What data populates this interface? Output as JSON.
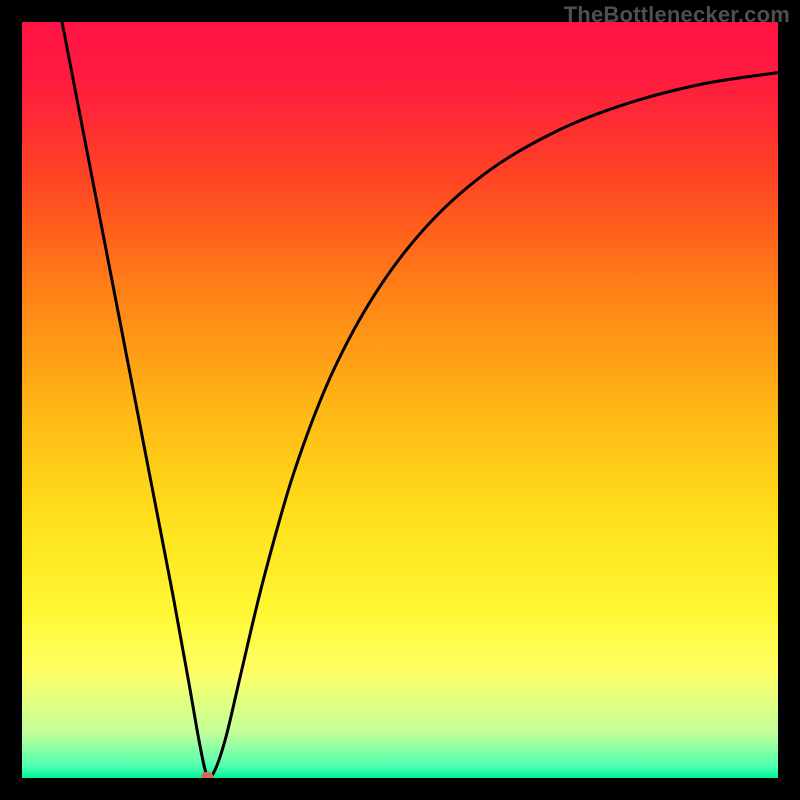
{
  "watermark": "TheBottlenecker.com",
  "chart_data": {
    "type": "line",
    "title": "",
    "xlabel": "",
    "ylabel": "",
    "xlim": [
      0,
      100
    ],
    "ylim": [
      0,
      100
    ],
    "gradient_stops": [
      {
        "offset": 0.0,
        "color": "#ff1345"
      },
      {
        "offset": 0.08,
        "color": "#ff1c3f"
      },
      {
        "offset": 0.2,
        "color": "#ff4224"
      },
      {
        "offset": 0.35,
        "color": "#ff7e17"
      },
      {
        "offset": 0.5,
        "color": "#ffb315"
      },
      {
        "offset": 0.65,
        "color": "#ffde1b"
      },
      {
        "offset": 0.78,
        "color": "#fff733"
      },
      {
        "offset": 0.86,
        "color": "#ffff66"
      },
      {
        "offset": 0.94,
        "color": "#c2ff9a"
      },
      {
        "offset": 0.985,
        "color": "#4dffb0"
      },
      {
        "offset": 1.0,
        "color": "#00f59b"
      }
    ],
    "curve": {
      "minimum_x": 24.5,
      "points": [
        {
          "x": 5.3,
          "y": 100.0
        },
        {
          "x": 8.0,
          "y": 86.0
        },
        {
          "x": 11.0,
          "y": 70.5
        },
        {
          "x": 14.0,
          "y": 55.0
        },
        {
          "x": 17.0,
          "y": 39.5
        },
        {
          "x": 20.0,
          "y": 24.0
        },
        {
          "x": 22.0,
          "y": 13.0
        },
        {
          "x": 23.5,
          "y": 4.5
        },
        {
          "x": 24.5,
          "y": 0.3
        },
        {
          "x": 25.5,
          "y": 1.0
        },
        {
          "x": 27.0,
          "y": 5.5
        },
        {
          "x": 29.0,
          "y": 14.0
        },
        {
          "x": 32.0,
          "y": 26.5
        },
        {
          "x": 36.0,
          "y": 40.5
        },
        {
          "x": 41.0,
          "y": 53.5
        },
        {
          "x": 47.0,
          "y": 64.5
        },
        {
          "x": 54.0,
          "y": 73.5
        },
        {
          "x": 62.0,
          "y": 80.5
        },
        {
          "x": 71.0,
          "y": 85.7
        },
        {
          "x": 80.0,
          "y": 89.2
        },
        {
          "x": 90.0,
          "y": 91.8
        },
        {
          "x": 100.0,
          "y": 93.3
        }
      ]
    },
    "marker": {
      "x": 24.5,
      "y": 0.0,
      "color": "#d86a52",
      "rx": 6,
      "ry": 4.2
    }
  }
}
